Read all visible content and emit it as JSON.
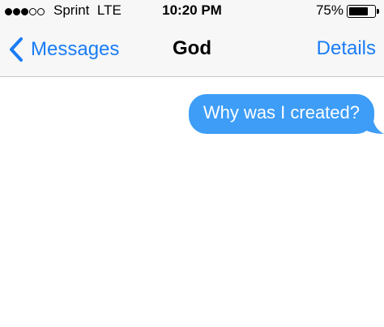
{
  "status_bar": {
    "signal_bars_filled": 3,
    "signal_bars_total": 5,
    "carrier": "Sprint",
    "network": "LTE",
    "time": "10:20 PM",
    "battery_percent": "75%",
    "battery_level": 0.75
  },
  "nav": {
    "back_label": "Messages",
    "title": "God",
    "details_label": "Details",
    "accent_color": "#1a7cf5"
  },
  "messages": [
    {
      "sender": "me",
      "text": "Why was I created?",
      "bubble_color": "#3d9df7"
    }
  ]
}
